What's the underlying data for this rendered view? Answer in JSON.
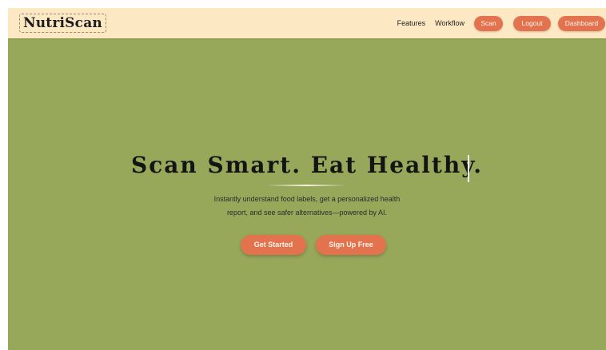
{
  "brand": {
    "logo_text": "NutriScan"
  },
  "nav": {
    "links": [
      "Features",
      "Workflow"
    ],
    "buttons": [
      "Scan",
      "Logout",
      "Dashboard"
    ]
  },
  "hero": {
    "title": "Scan Smart. Eat Healthy.",
    "subtitle_line1": "Instantly understand food labels, get a personalized health",
    "subtitle_line2": "report, and see safer alternatives—powered by AI.",
    "primary_cta": "Get Started",
    "secondary_cta": "Sign Up Free"
  },
  "colors": {
    "page_background": "#98a85a",
    "navbar_background": "#fde8c4",
    "accent": "#e3734f",
    "text_dark": "#141414"
  }
}
